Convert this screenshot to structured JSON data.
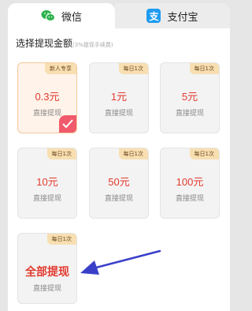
{
  "tabs": [
    {
      "label": "微信",
      "icon": "wechat-icon",
      "active": true
    },
    {
      "label": "支付宝",
      "icon": "alipay-icon",
      "icon_glyph": "支",
      "active": false
    }
  ],
  "section": {
    "title": "选择提现金额",
    "note": "(3%提现手续费)"
  },
  "options": [
    {
      "badge": "新人专享",
      "amount": "0.3元",
      "sub": "直接提现",
      "selected": true
    },
    {
      "badge": "每日1次",
      "amount": "1元",
      "sub": "直接提现",
      "selected": false
    },
    {
      "badge": "每日1次",
      "amount": "5元",
      "sub": "直接提现",
      "selected": false
    },
    {
      "badge": "每日1次",
      "amount": "10元",
      "sub": "直接提现",
      "selected": false
    },
    {
      "badge": "每日1次",
      "amount": "50元",
      "sub": "直接提现",
      "selected": false
    },
    {
      "badge": "每日1次",
      "amount": "100元",
      "sub": "直接提现",
      "selected": false
    },
    {
      "badge": "每日1次",
      "amount": "全部提现",
      "sub": "直接提现",
      "selected": false
    }
  ],
  "colors": {
    "accent": "#e23a2e",
    "badge_bg": "#f8dfb1",
    "check": "#f05a6a",
    "wechat": "#2bb24c",
    "alipay": "#1e9bf0",
    "arrow": "#3a3fc9"
  }
}
